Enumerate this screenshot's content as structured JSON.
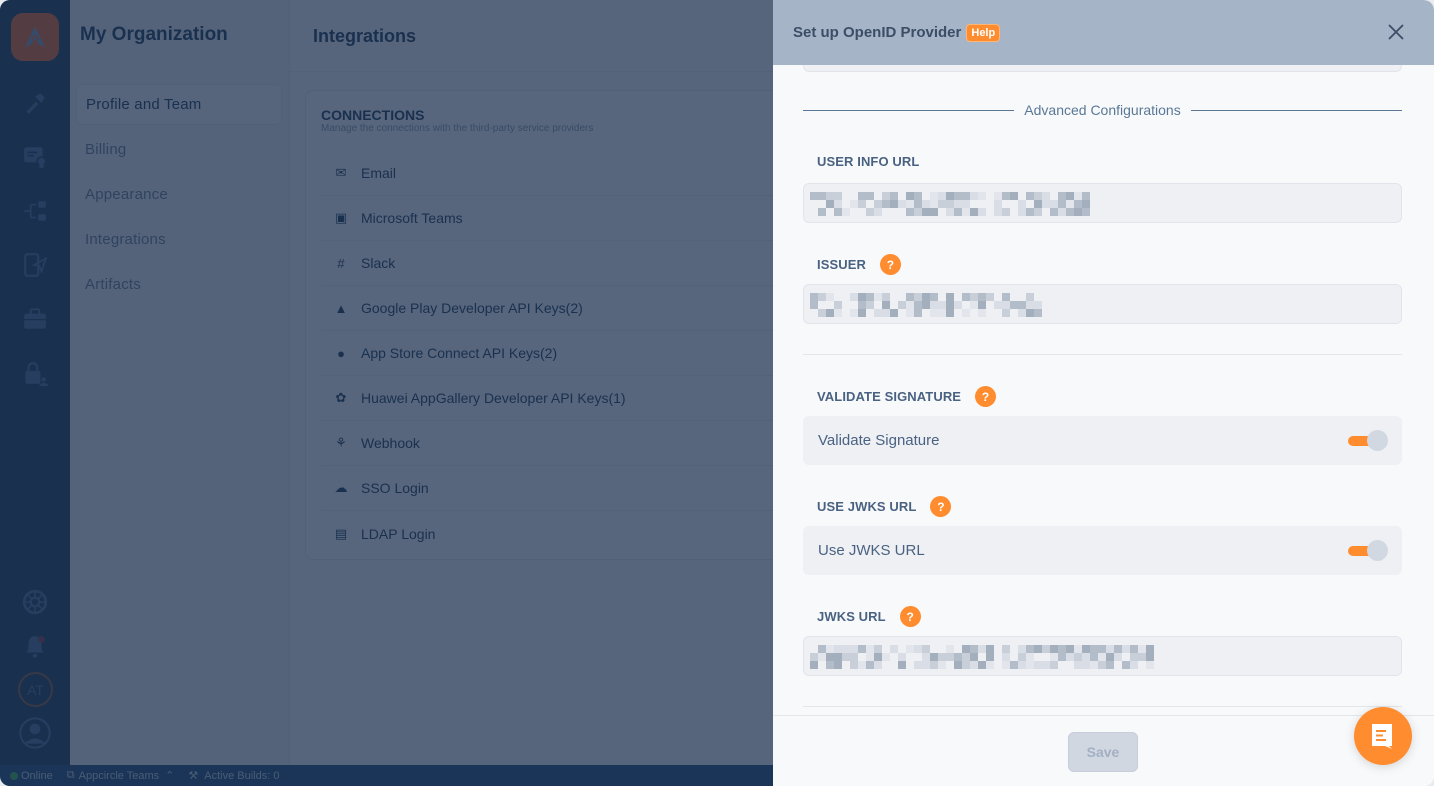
{
  "app": {
    "rail": {
      "icons": [
        "appcircle-logo-icon",
        "build-hammer-icon",
        "signing-certificate-icon",
        "distribution-flow-icon",
        "testing-distribution-icon",
        "enterprise-store-briefcase-icon",
        "publish-lock-user-icon"
      ],
      "bottom_icons": [
        "settings-gear-icon",
        "notifications-bell-icon",
        "user-initials-avatar",
        "profile-avatar-icon"
      ],
      "avatar_initials": "AT",
      "notification_dot_color": "#e04848"
    },
    "org_panel": {
      "title": "My Organization",
      "nav": [
        {
          "label": "Profile and Team",
          "active": true
        },
        {
          "label": "Billing",
          "active": false
        },
        {
          "label": "Appearance",
          "active": false
        },
        {
          "label": "Integrations",
          "active": false
        },
        {
          "label": "Artifacts",
          "active": false
        }
      ]
    },
    "main": {
      "title": "Integrations",
      "connections": {
        "title": "CONNECTIONS",
        "subtitle": "Manage the connections with the third-party service providers",
        "items": [
          {
            "label": "Email",
            "icon": "envelope-open-icon"
          },
          {
            "label": "Microsoft Teams",
            "icon": "microsoft-teams-icon"
          },
          {
            "label": "Slack",
            "icon": "slack-icon"
          },
          {
            "label": "Google Play Developer API Keys(2)",
            "icon": "android-icon"
          },
          {
            "label": "App Store Connect API Keys(2)",
            "icon": "apple-icon"
          },
          {
            "label": "Huawei AppGallery Developer API Keys(1)",
            "icon": "huawei-icon"
          },
          {
            "label": "Webhook",
            "icon": "webhook-icon"
          },
          {
            "label": "SSO Login",
            "icon": "cloud-key-icon"
          },
          {
            "label": "LDAP Login",
            "icon": "network-server-icon"
          }
        ]
      }
    },
    "statusbar": {
      "online": "Online",
      "team": "Appcircle Teams",
      "active_builds": "Active Builds: 0"
    }
  },
  "drawer": {
    "title": "Set up OpenID Provider",
    "help_label": "Help",
    "section_label": "Advanced Configurations",
    "fields": {
      "user_info_url": {
        "label": "USER INFO URL",
        "value_redacted": true
      },
      "issuer": {
        "label": "ISSUER",
        "value_redacted": true
      },
      "validate_signature": {
        "label": "VALIDATE SIGNATURE",
        "toggle_label": "Validate Signature",
        "enabled": true
      },
      "use_jwks_url": {
        "label": "USE JWKS URL",
        "toggle_label": "Use JWKS URL",
        "enabled": true
      },
      "jwks_url": {
        "label": "JWKS URL",
        "value_redacted": true
      }
    },
    "help_icon_glyph": "?",
    "save_label": "Save"
  },
  "colors": {
    "accent_orange": "#ff8c2f",
    "navy": "#1b3a5c",
    "header_bg": "#a6b4c8",
    "field_bg": "#eef0f4"
  }
}
